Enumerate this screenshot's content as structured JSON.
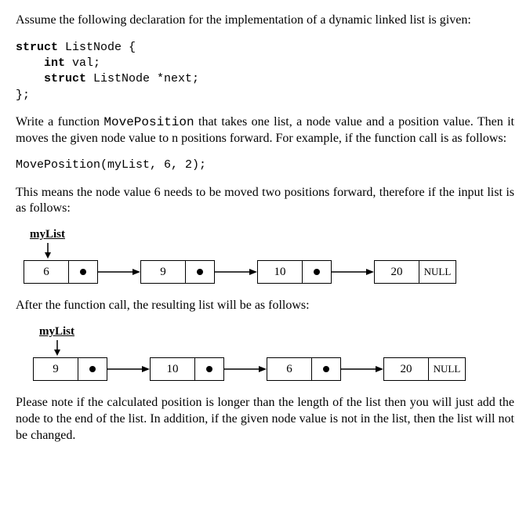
{
  "intro": "Assume the following declaration for the implementation of a dynamic linked list is given:",
  "code_block": "struct ListNode {\n    int val;\n    struct ListNode *next;\n};",
  "code_block_html": "<span class=\"bold\">struct</span> ListNode {\n    <span class=\"bold\">int</span> val;\n    <span class=\"bold\">struct</span> ListNode *next;\n};",
  "para2_pre": "Write a function ",
  "para2_func": "MovePosition",
  "para2_post": " that takes one list, a node value and a position value. Then it moves the given node value to n positions forward. For example, if the function call is as follows:",
  "call_line": "MovePosition(myList, 6, 2);",
  "para3": "This means the node value 6 needs to be moved two positions forward, therefore if the input list is as follows:",
  "label1": "myList",
  "list1": {
    "n0": "6",
    "n1": "9",
    "n2": "10",
    "n3": "20",
    "null": "NULL"
  },
  "para4": "After the function call, the resulting list will be as follows:",
  "label2": "myList",
  "list2": {
    "n0": "9",
    "n1": "10",
    "n2": "6",
    "n3": "20",
    "null": "NULL"
  },
  "para5": "Please note if the calculated position is longer than the length of the list then you will just add the node to the end of the list. In addition, if the given node value is not in the list, then the list will not be changed."
}
